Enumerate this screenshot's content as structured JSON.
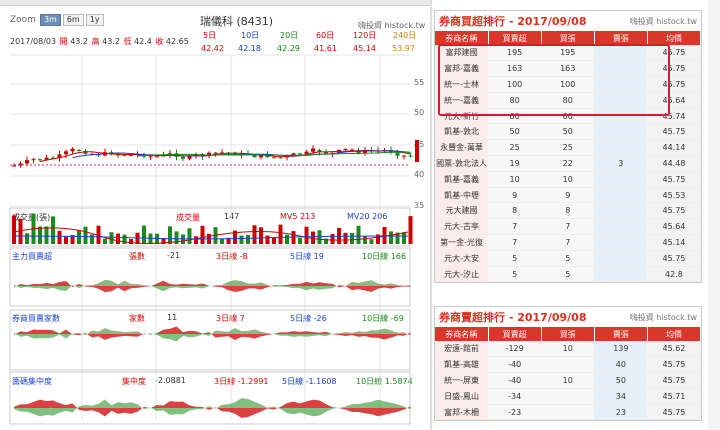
{
  "chart": {
    "zoom_label": "Zoom",
    "zoom_buttons": [
      "3m",
      "6m",
      "1y"
    ],
    "title": "瑞儀科 (8431)",
    "watermark": "嗨投資 histock.tw",
    "info": {
      "date": "2017/08/03",
      "open_label": "開",
      "open": "43.2",
      "high_label": "高",
      "high": "43.2",
      "low_label": "低",
      "low": "42.4",
      "close_label": "收",
      "close": "42.65"
    },
    "ma_labels": [
      "5日",
      "10日",
      "20日",
      "60日",
      "120日",
      "240日"
    ],
    "ma_values": [
      "42.42",
      "42.18",
      "42.29",
      "41.61",
      "45.14",
      "53.97"
    ],
    "y_axis": [
      "55",
      "50",
      "45",
      "40",
      "35"
    ],
    "volume": {
      "label": "成交量(張)",
      "vol_label": "成交量",
      "vol_value": "147",
      "mv5": "MV5 213",
      "mv20": "MV20 206"
    },
    "main_force": {
      "label": "主力買賣超",
      "sheets_label": "張數",
      "sheets": "-21",
      "d3": "3日線 -8",
      "d5": "5日線 19",
      "d10": "10日線 166"
    },
    "broker_count": {
      "label": "券商買賣家數",
      "count_label": "家數",
      "count": "11",
      "d3": "3日線 7",
      "d5": "5日線 -26",
      "d10": "10日線 -69"
    },
    "concentration": {
      "label": "籌碼集中度",
      "conc_label": "集中度",
      "conc": "-2.0881",
      "d3": "3日線 -1.2991",
      "d5": "5日線 -1.1608",
      "d10": "10日線 1.5874"
    }
  },
  "panel1": {
    "title": "券商買超排行 - 2017/09/08",
    "watermark": "嗨投資 histock.tw",
    "headers": [
      "券商名稱",
      "買賣超",
      "買張",
      "賣張",
      "均價"
    ],
    "rows": [
      [
        "富邦建國",
        "195",
        "195",
        "",
        "45.75"
      ],
      [
        "富邦-嘉義",
        "163",
        "163",
        "",
        "45.75"
      ],
      [
        "統一-士林",
        "100",
        "100",
        "",
        "45.75"
      ],
      [
        "統一-嘉義",
        "80",
        "80",
        "",
        "45.64"
      ],
      [
        "元大-新竹",
        "60",
        "60",
        "",
        "45.74"
      ],
      [
        "凱基-敦北",
        "50",
        "50",
        "",
        "45.75"
      ],
      [
        "永豐金-萬華",
        "25",
        "25",
        "",
        "44.14"
      ],
      [
        "國票-敦北法人",
        "19",
        "22",
        "3",
        "44.48"
      ],
      [
        "凱基-嘉義",
        "10",
        "10",
        "",
        "45.75"
      ],
      [
        "凱基-中壢",
        "9",
        "9",
        "",
        "45.53"
      ],
      [
        "元大建國",
        "8",
        "8",
        "",
        "45.75"
      ],
      [
        "元大-古亭",
        "7",
        "7",
        "",
        "45.64"
      ],
      [
        "第一金-光復",
        "7",
        "7",
        "",
        "45.14"
      ],
      [
        "元大-大安",
        "5",
        "5",
        "",
        "45.75"
      ],
      [
        "元大-汐止",
        "5",
        "5",
        "",
        "42.8"
      ]
    ]
  },
  "panel2": {
    "title": "券商賣超排行 - 2017/09/08",
    "watermark": "嗨投資 histock.tw",
    "headers": [
      "券商名稱",
      "買賣超",
      "買張",
      "賣張",
      "均價"
    ],
    "rows": [
      [
        "宏遠-館前",
        "-129",
        "10",
        "139",
        "45.62"
      ],
      [
        "凱基-高雄",
        "-40",
        "",
        "40",
        "45.75"
      ],
      [
        "統一-屏東",
        "-40",
        "10",
        "50",
        "45.75"
      ],
      [
        "日盛-鳳山",
        "-34",
        "",
        "34",
        "45.71"
      ],
      [
        "富邦-木柵",
        "-23",
        "",
        "23",
        "45.75"
      ]
    ]
  },
  "colors": {
    "up": "#d00000",
    "down": "#1a8a1a",
    "ma5": "#d00000",
    "ma10": "#1a3fd8",
    "ma20": "#1a8a1a",
    "header": "#d8372a",
    "highlight": "#d21f2f"
  }
}
